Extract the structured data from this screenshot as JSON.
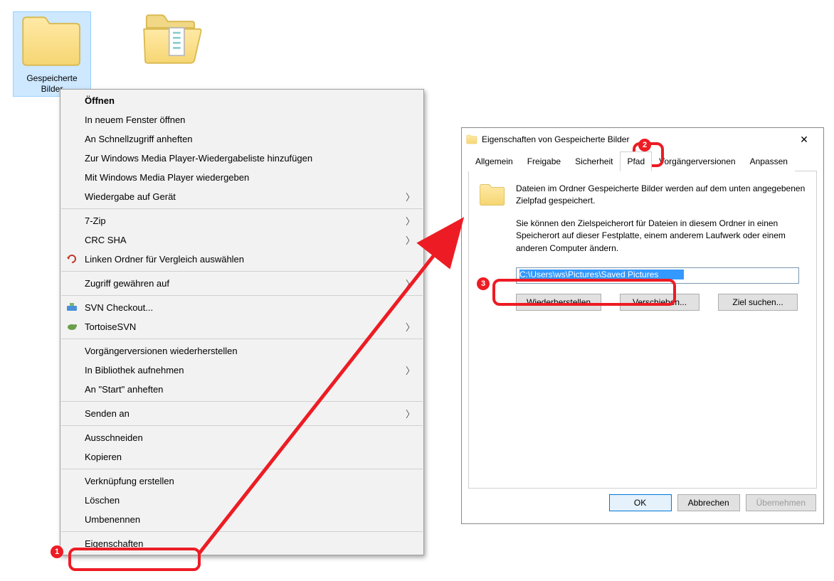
{
  "desktop": {
    "folder1": {
      "label": "Gespeicherte\nBilder",
      "selected": true
    },
    "folder2": {
      "label": ""
    }
  },
  "context_menu": [
    {
      "label": "Öffnen",
      "bold": true
    },
    {
      "label": "In neuem Fenster öffnen"
    },
    {
      "label": "An Schnellzugriff anheften"
    },
    {
      "label": "Zur Windows Media Player-Wiedergabeliste hinzufügen"
    },
    {
      "label": "Mit Windows Media Player wiedergeben"
    },
    {
      "label": "Wiedergabe auf Gerät",
      "submenu": true
    },
    {
      "sep": true
    },
    {
      "label": "7-Zip",
      "submenu": true
    },
    {
      "label": "CRC SHA",
      "submenu": true
    },
    {
      "label": "Linken Ordner für Vergleich auswählen",
      "icon": "undo-icon"
    },
    {
      "sep": true
    },
    {
      "label": "Zugriff gewähren auf",
      "submenu": true
    },
    {
      "sep": true
    },
    {
      "label": "SVN Checkout...",
      "icon": "svn-icon"
    },
    {
      "label": "TortoiseSVN",
      "icon": "tortoise-icon",
      "submenu": true
    },
    {
      "sep": true
    },
    {
      "label": "Vorgängerversionen wiederherstellen"
    },
    {
      "label": "In Bibliothek aufnehmen",
      "submenu": true
    },
    {
      "label": "An \"Start\" anheften"
    },
    {
      "sep": true
    },
    {
      "label": "Senden an",
      "submenu": true
    },
    {
      "sep": true
    },
    {
      "label": "Ausschneiden"
    },
    {
      "label": "Kopieren"
    },
    {
      "sep": true
    },
    {
      "label": "Verknüpfung erstellen"
    },
    {
      "label": "Löschen"
    },
    {
      "label": "Umbenennen"
    },
    {
      "sep": true
    },
    {
      "label": "Eigenschaften"
    }
  ],
  "dialog": {
    "title": "Eigenschaften von Gespeicherte Bilder",
    "tabs": [
      "Allgemein",
      "Freigabe",
      "Sicherheit",
      "Pfad",
      "Vorgängerversionen",
      "Anpassen"
    ],
    "active_tab": 3,
    "info1": "Dateien im Ordner Gespeicherte Bilder werden auf dem unten angegebenen Zielpfad gespeichert.",
    "info2": "Sie können den Zielspeicherort für Dateien in diesem Ordner in einen Speicherort auf dieser Festplatte, einem anderem Laufwerk oder einem anderen Computer ändern.",
    "path_value": "C:\\Users\\ws\\Pictures\\Saved Pictures",
    "btn_restore": "Wiederherstellen",
    "btn_move": "Verschieben...",
    "btn_find": "Ziel suchen...",
    "btn_ok": "OK",
    "btn_cancel": "Abbrechen",
    "btn_apply": "Übernehmen"
  },
  "annotations": {
    "n1": "1",
    "n2": "2",
    "n3": "3"
  }
}
